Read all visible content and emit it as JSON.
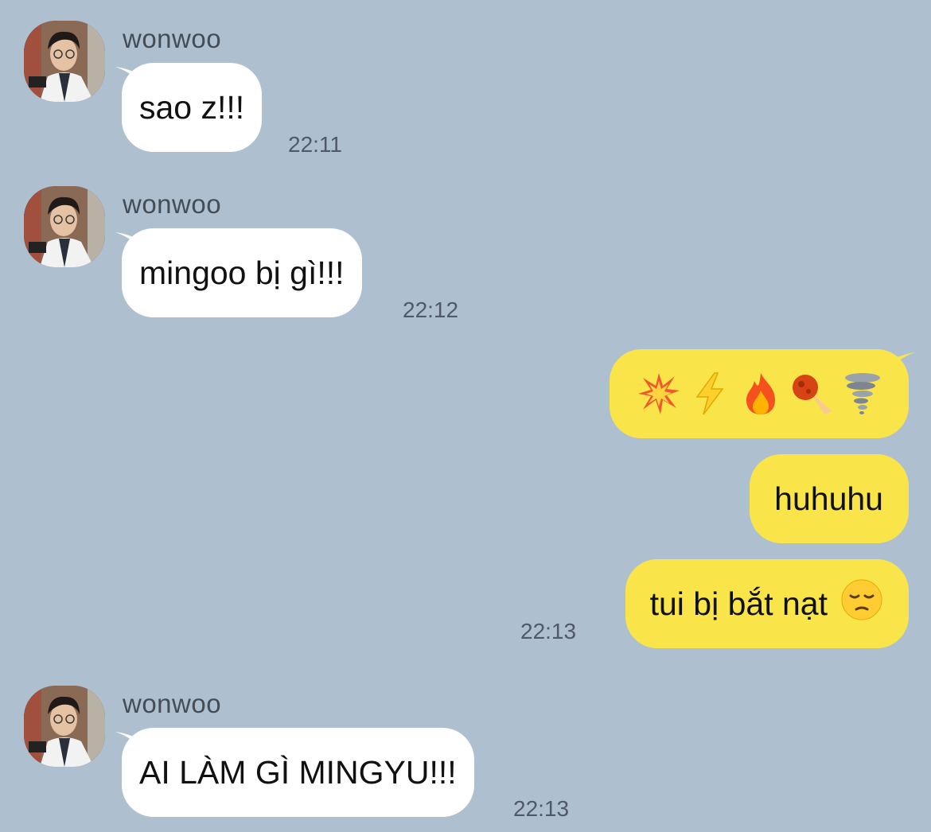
{
  "messages": [
    {
      "side": "in",
      "sender": "wonwoo",
      "text": "sao z!!!",
      "time": "22:11"
    },
    {
      "side": "in",
      "sender": "wonwoo",
      "text": "mingoo bị gì!!!",
      "time": "22:12"
    },
    {
      "side": "out",
      "emojis": [
        "collision-icon",
        "lightning-icon",
        "fire-icon",
        "comet-icon",
        "tornado-icon"
      ]
    },
    {
      "side": "out",
      "text": "huhuhu"
    },
    {
      "side": "out",
      "text": "tui bị bắt nạt",
      "emoji": "pensive-face-icon",
      "time": "22:13"
    },
    {
      "side": "in",
      "sender": "wonwoo",
      "text": "AI LÀM GÌ MINGYU!!!",
      "time": "22:13"
    }
  ],
  "colors": {
    "background": "#aec0d0",
    "incoming_bubble": "#ffffff",
    "outgoing_bubble": "#f9e54a",
    "timestamp": "#50596a",
    "sender_name": "#444c55"
  }
}
